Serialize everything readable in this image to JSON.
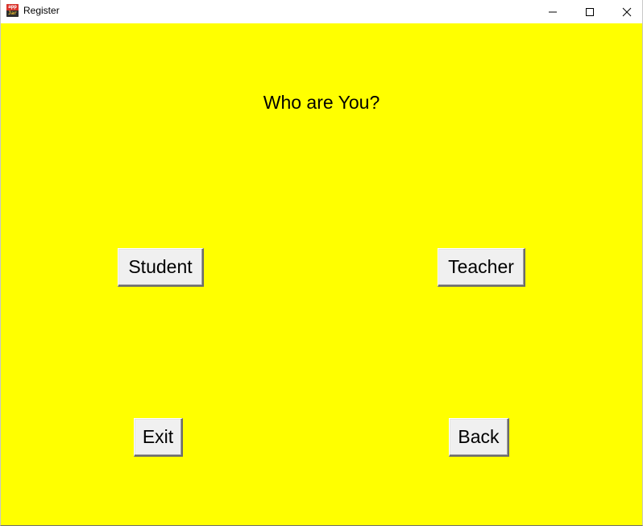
{
  "window": {
    "title": "Register",
    "app_icon": {
      "name": "app-jar-icon",
      "top_text": "app",
      "bottom_text": "Jar"
    },
    "controls": {
      "minimize_icon": "minimize-icon",
      "maximize_icon": "maximize-icon",
      "close_icon": "close-icon"
    }
  },
  "main": {
    "background_color": "#ffff00",
    "heading": "Who are You?",
    "buttons": {
      "student": "Student",
      "teacher": "Teacher",
      "exit": "Exit",
      "back": "Back"
    }
  }
}
